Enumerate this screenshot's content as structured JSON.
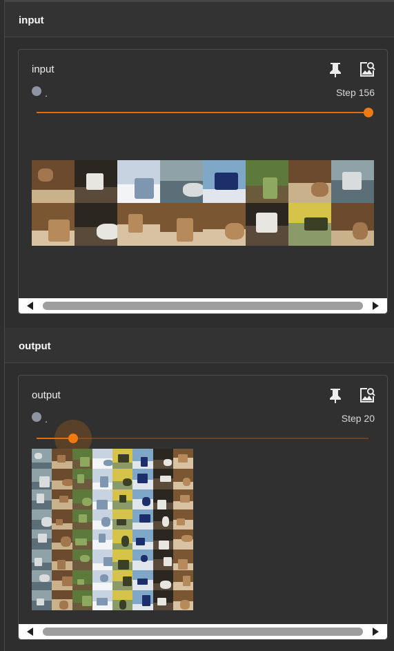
{
  "sections": [
    {
      "header": "input",
      "card": {
        "title": "input",
        "run_label": ".",
        "step_label": "Step 156",
        "slider_fraction": 1.0,
        "grid_cols": 8,
        "grid_rows": 2,
        "images": [
          "horse",
          "dog",
          "boat",
          "airplane",
          "ship",
          "deer",
          "horse",
          "airplane",
          "cat",
          "dog",
          "cat",
          "cat",
          "cat",
          "dog",
          "automobile",
          "horse"
        ]
      }
    },
    {
      "header": "output",
      "card": {
        "title": "output",
        "run_label": ".",
        "step_label": "Step 20",
        "slider_fraction": 0.11,
        "grid_cols": 8,
        "grid_rows": 8
      }
    }
  ],
  "icons": {
    "pin": "pin-icon",
    "expand": "expand-image-icon",
    "scroll_left": "arrow-left-icon",
    "scroll_right": "arrow-right-icon"
  },
  "colors": {
    "accent": "#ef7a12",
    "run_dot": "#8d95a3",
    "panel_bg": "#303030"
  }
}
